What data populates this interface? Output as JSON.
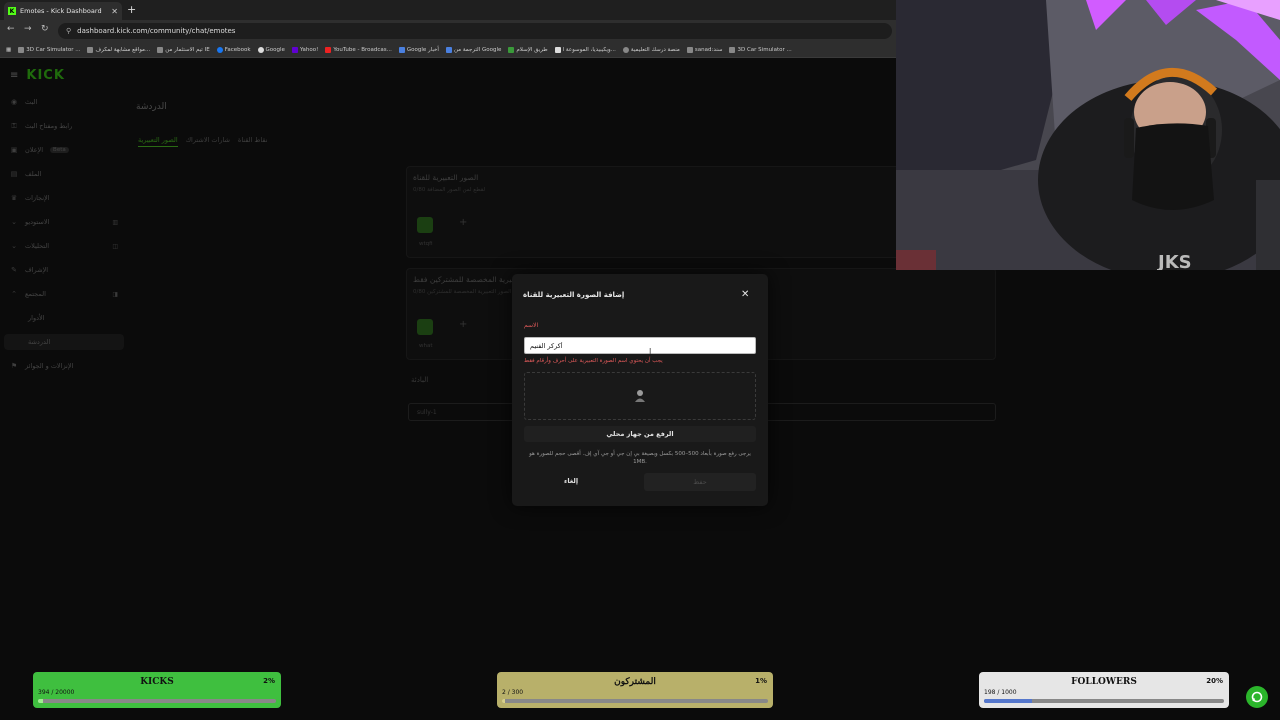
{
  "browser": {
    "tab_title": "Emotes - Kick Dashboard",
    "new_tab": "+",
    "url": "dashboard.kick.com/community/chat/emotes",
    "bookmarks": [
      "3D Car Simulator ...",
      "مواقع مشابهة لمكرف...",
      "تيم الاستثمار من IE",
      "Facebook",
      "Google",
      "Yahoo!",
      "YouTube - Broadcas...",
      "Google أخبار",
      "الترجمة من Google",
      "طريق الإسلام",
      "ويكيبيديا، الموسوعة ا...",
      "منصة درسك التعليمية",
      "sanad:سند",
      "3D Car Simulator ..."
    ]
  },
  "sidebar": {
    "logo": "KICK",
    "items": [
      {
        "label": "البث",
        "icon": "live-icon"
      },
      {
        "label": "رابط ومفتاح البث",
        "icon": "key-icon"
      },
      {
        "label": "الإعلان",
        "icon": "ad-icon",
        "badge": "Beta"
      },
      {
        "label": "الملف",
        "icon": "profile-icon"
      },
      {
        "label": "الإنجازات",
        "icon": "trophy-icon"
      },
      {
        "label": "الاستوديو",
        "icon": "studio-icon"
      },
      {
        "label": "التحليلات",
        "icon": "analytics-icon"
      },
      {
        "label": "الإشراف",
        "icon": "moderation-icon"
      },
      {
        "label": "المجتمع",
        "icon": "community-icon"
      },
      {
        "label": "الأدوار",
        "icon": ""
      },
      {
        "label": "الدردشة",
        "icon": ""
      },
      {
        "label": "الإنزالات و الجوائز",
        "icon": "drops-icon"
      }
    ]
  },
  "page": {
    "title": "الدردشة",
    "tabs": [
      "الصور التعبيرية",
      "شارات الاشتراك",
      "نقاط القناة"
    ],
    "section1": {
      "title": "الصور التعبيرية للقناة",
      "subtitle": "لقطع لمن الصور المضافة 0/80",
      "emote": "wtqfi"
    },
    "section2": {
      "title": "الصور التعبيرية المخصصة للمشتركين فقط",
      "subtitle": "الصور التعبيرية المخصصة للمشتركين 0/80",
      "emote": "what"
    },
    "section3": {
      "title": "البادئة",
      "value": "sully-1"
    }
  },
  "modal": {
    "title": "إضافة الصورة التعبيرية للقناة",
    "name_label": "الاسم",
    "name_value": "أكركر الفنيم",
    "error": "يجب أن يحتوي اسم الصورة التعبيرية على أحرف وأرقام فقط",
    "upload_button": "الرفع من جهاز محلي",
    "help_text": "يرجى رفع صورة بأبعاد 500–500 بكسل وبصيغة بي إن جي أو جي آي إف. أقصى حجم للصورة هو 1MB.",
    "cancel": "إلغاء",
    "save": "حفظ"
  },
  "goals": {
    "kicks": {
      "title": "KICKS",
      "percent": "2%",
      "count": "394 / 20000",
      "fraction": 0.02,
      "color": "#3fbf3f"
    },
    "subs": {
      "title": "المشتركون",
      "percent": "1%",
      "count": "2 / 300",
      "fraction": 0.01,
      "color": "#b8b06a"
    },
    "followers": {
      "title": "FOLLOWERS",
      "percent": "20%",
      "count": "198 / 1000",
      "fraction": 0.2,
      "color": "#5577cc"
    }
  }
}
